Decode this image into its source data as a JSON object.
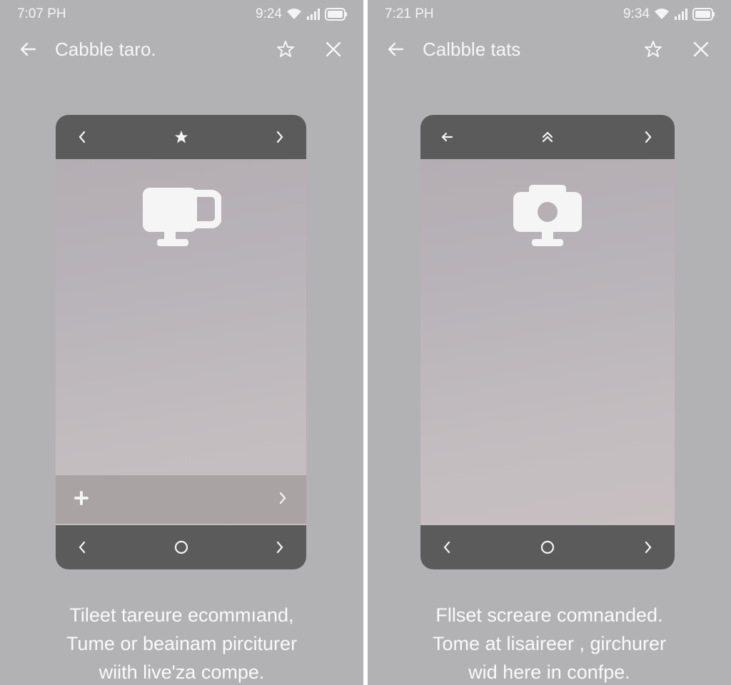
{
  "screens": [
    {
      "status_time": "7:07 PH",
      "status_clock": "9:24",
      "title": "Cabble taro.",
      "caption": [
        "Tileet tareure ecommıand,",
        "Tume or beainam pirciturer",
        "wiith live'za compe."
      ],
      "top_bar_icons": [
        "chevron-left-icon",
        "star-filled-icon",
        "chevron-right-icon"
      ],
      "bottom_bar_icons": [
        "chevron-left-icon",
        "circle-icon",
        "chevron-right-icon"
      ],
      "card_icon": "monitor-mug-icon"
    },
    {
      "status_time": "7:21 PH",
      "status_clock": "9:34",
      "title": "Calbble tats",
      "caption": [
        "Fllset screare comnanded.",
        "Tome at lisaireer , girchurer",
        "wid here in confpe."
      ],
      "top_bar_icons": [
        "arrow-left-icon",
        "double-chevron-up-icon",
        "chevron-right-icon"
      ],
      "bottom_bar_icons": [
        "chevron-left-icon",
        "circle-icon",
        "chevron-right-icon"
      ],
      "card_icon": "monitor-camera-icon"
    }
  ],
  "colors": {
    "background": "#b2b1b4",
    "bar": "#5b5b5c",
    "text": "#f6f6f8"
  }
}
